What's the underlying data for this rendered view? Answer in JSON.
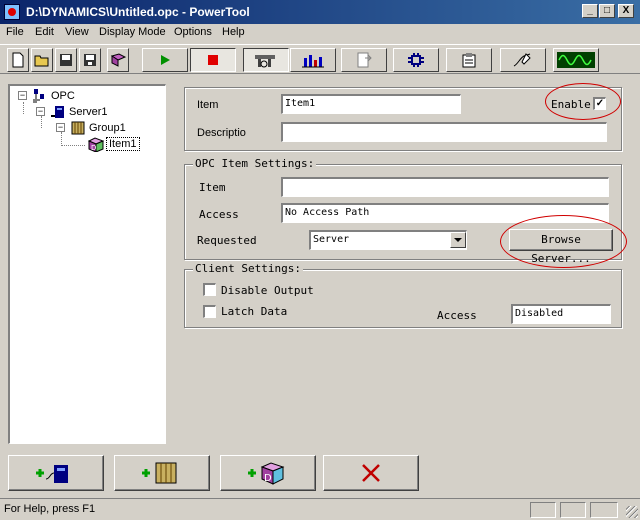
{
  "window": {
    "title": "D:\\DYNAMICS\\Untitled.opc - PowerTool",
    "minimize": "_",
    "maximize": "□",
    "close": "X"
  },
  "menu": {
    "items": [
      {
        "label": "File"
      },
      {
        "label": "Edit"
      },
      {
        "label": "View"
      },
      {
        "label": "Display Mode"
      },
      {
        "label": "Options"
      },
      {
        "label": "Help"
      }
    ]
  },
  "toolbar": {
    "icons": [
      "new-icon",
      "open-icon",
      "save-icon",
      "save-all-icon",
      "book-icon",
      "play-icon",
      "stop-icon",
      "properties-icon",
      "statistics-icon",
      "file-export-icon",
      "network-icon",
      "document-icon",
      "signature-icon",
      "waveform-icon"
    ]
  },
  "tree": {
    "nodes": [
      {
        "label": "OPC",
        "icon": "opc-icon"
      },
      {
        "label": "Server1",
        "icon": "server-icon"
      },
      {
        "label": "Group1",
        "icon": "group-icon"
      },
      {
        "label": "Item1",
        "icon": "item-icon"
      }
    ]
  },
  "item_panel": {
    "item_label": "Item",
    "item_value": "Item1",
    "description_label": "Descriptio",
    "description_value": "",
    "enable_label": "Enable",
    "enable_checked": "✓"
  },
  "opc_settings": {
    "title": "OPC Item Settings:",
    "item_label": "Item",
    "item_value": "",
    "access_label": "Access",
    "access_value": "No Access Path",
    "requested_label": "Requested",
    "requested_value": "Server",
    "browse_button": "Browse Server..."
  },
  "client_settings": {
    "title": "Client Settings:",
    "disable_output_label": "Disable Output",
    "latch_data_label": "Latch Data",
    "access_label": "Access",
    "access_value": "Disabled"
  },
  "bottom_buttons": [
    "add-server-icon",
    "add-group-icon",
    "add-item-icon",
    "delete-icon"
  ],
  "status": {
    "text": "For Help, press F1"
  },
  "colors": {
    "face": "#d4d0c8",
    "title_start": "#0a246a",
    "title_end": "#3a6ea5",
    "annotation": "#d00000"
  }
}
